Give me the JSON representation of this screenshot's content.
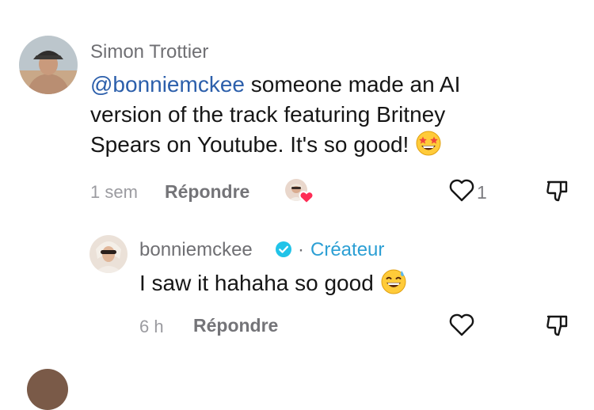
{
  "comments": [
    {
      "author": "Simon Trottier",
      "mention": "@bonniemckee",
      "text_lines": [
        " someone made an AI",
        "version of the track featuring Britney",
        "Spears on Youtube. It's so good!"
      ],
      "emoji": "star-struck-emoji",
      "time": "1 sem",
      "reply_label": "Répondre",
      "likes": "1",
      "creator_liked": true
    },
    {
      "author": "bonniemckee",
      "verified": true,
      "creator_label": "Créateur",
      "separator": "·",
      "text": "I saw it hahaha so good",
      "emoji": "grinning-sweat-emoji",
      "time": "6 h",
      "reply_label": "Répondre"
    }
  ],
  "colors": {
    "mention": "#2c5fab",
    "verified": "#21c3e8",
    "creator_heart": "#fe2c55",
    "muted_text": "#9b9ba0"
  }
}
